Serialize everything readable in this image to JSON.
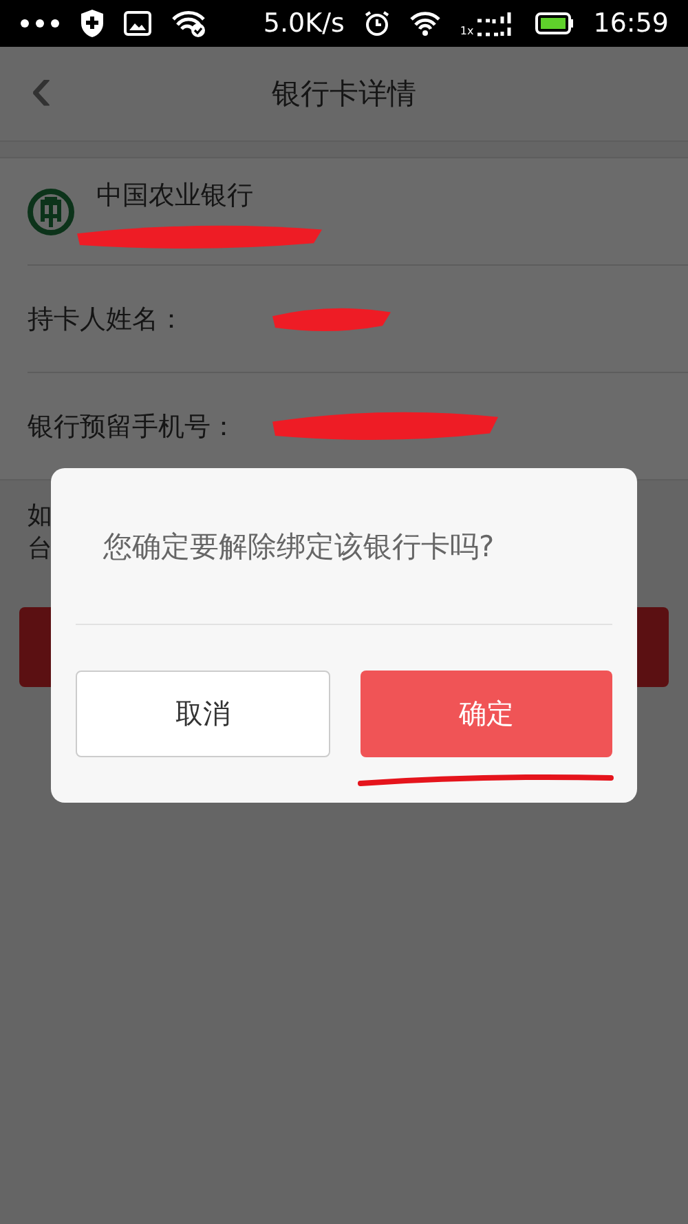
{
  "status_bar": {
    "speed": "5.0K/s",
    "network": "1x",
    "time": "16:59"
  },
  "header": {
    "back": "‹",
    "title": "银行卡详情"
  },
  "card": {
    "bank_name": "中国农业银行",
    "rows": [
      {
        "label": "持卡人姓名："
      },
      {
        "label": "银行预留手机号："
      }
    ]
  },
  "hint": {
    "lines": [
      "如",
      "台"
    ]
  },
  "dialog": {
    "message": "您确定要解除绑定该银行卡吗?",
    "buttons": [
      {
        "label": "取消",
        "kind": "cancel"
      },
      {
        "label": "确定",
        "kind": "confirm"
      }
    ]
  }
}
